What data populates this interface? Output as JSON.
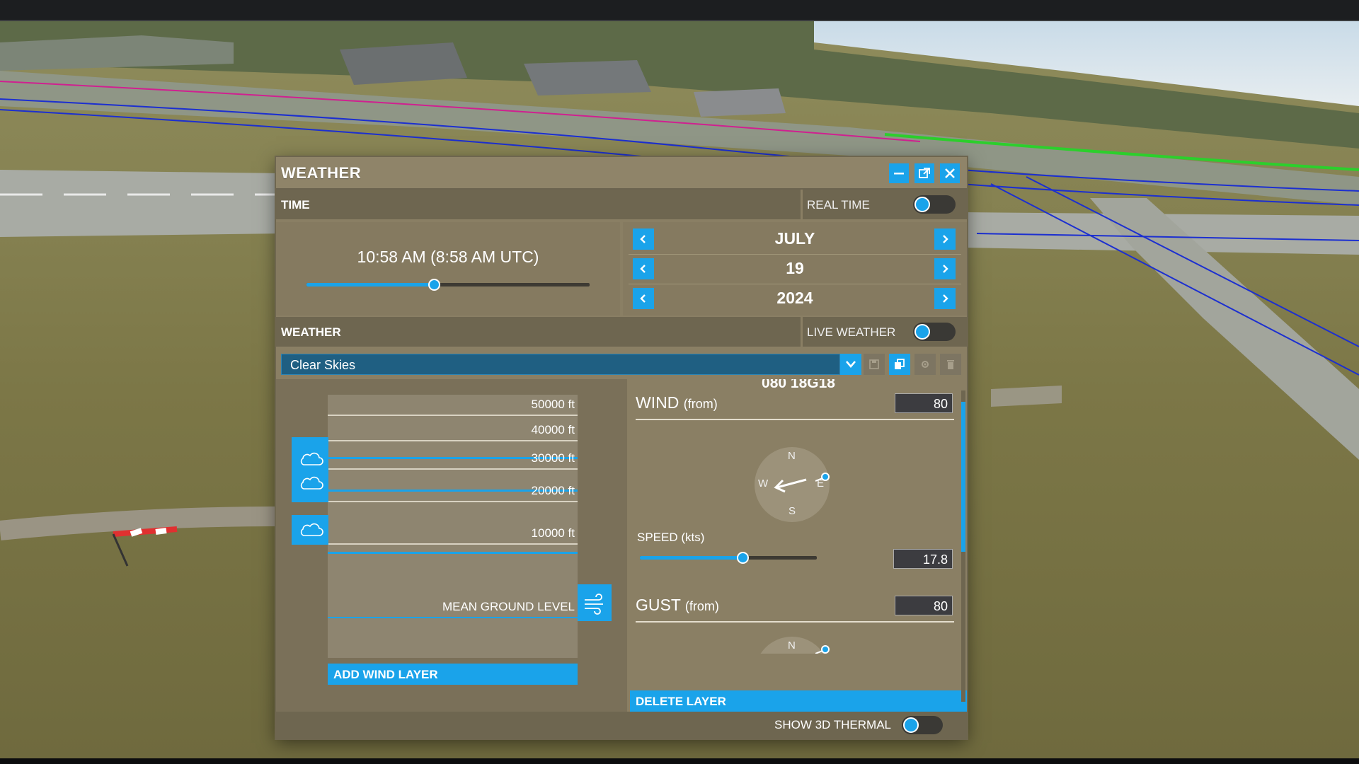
{
  "window": {
    "title": "WEATHER",
    "buttons": [
      "minimize",
      "pop-out",
      "close"
    ]
  },
  "time_section": {
    "label": "TIME",
    "real_time_label": "REAL TIME",
    "real_time_on": false,
    "time_value": "10:58 AM (8:58 AM UTC)",
    "time_slider_fraction": 0.45
  },
  "date": {
    "month": "JULY",
    "day": "19",
    "year": "2024"
  },
  "weather_section": {
    "label": "WEATHER",
    "live_weather_label": "LIVE WEATHER",
    "live_weather_on": false,
    "preset_value": "Clear Skies"
  },
  "altitude_chart": {
    "levels": [
      "50000 ft",
      "40000 ft",
      "30000 ft",
      "20000 ft",
      "10000 ft"
    ],
    "ground_label": "MEAN GROUND LEVEL",
    "add_wind_layer_label": "ADD WIND LAYER"
  },
  "wind": {
    "partial_header": "080 18G18",
    "title": "WIND",
    "title_suffix": "(from)",
    "direction_value": "80",
    "compass": {
      "n": "N",
      "e": "E",
      "s": "S",
      "w": "W"
    },
    "speed_label": "SPEED (kts)",
    "speed_value": "17.8",
    "speed_slider_fraction": 0.58
  },
  "gust": {
    "title": "GUST",
    "title_suffix": "(from)",
    "direction_value": "80",
    "compass_n": "N"
  },
  "delete_layer_label": "DELETE LAYER",
  "footer": {
    "show_3d_thermal_label": "SHOW 3D THERMAL",
    "show_3d_thermal_on": false
  },
  "colors": {
    "accent": "#1aa3ea",
    "panel": "#8a7f64",
    "panel_dark": "#6e6650"
  },
  "icons": [
    "minimize-icon",
    "popout-icon",
    "close-icon",
    "chevron-left-icon",
    "chevron-right-icon",
    "chevron-down-icon",
    "save-icon",
    "copy-icon",
    "settings-icon",
    "trash-icon",
    "cloud-icon",
    "wind-icon"
  ]
}
